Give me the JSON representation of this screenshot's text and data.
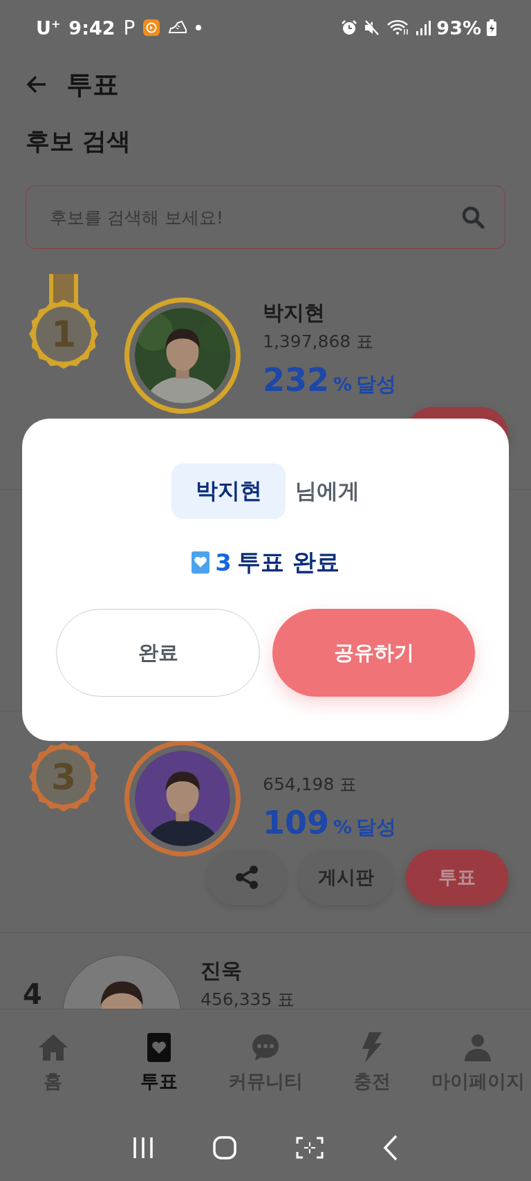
{
  "status_bar": {
    "carrier": "U$^{+}$",
    "time": "9:42",
    "app_letter": "P",
    "battery": "93%"
  },
  "header": {
    "title": "투표"
  },
  "search": {
    "heading": "후보 검색",
    "placeholder": "후보를 검색해 보세요!"
  },
  "candidates": [
    {
      "rank": "1",
      "kind": "medal",
      "color": "#d4a52a",
      "ribbon": true,
      "name": "박지현",
      "votes": "1,397,868 표",
      "percent": "232",
      "percent_unit": "%",
      "percent_label": "달성",
      "photo": {
        "kind": "picture"
      },
      "actions": [
        {
          "kind": "vote"
        }
      ]
    },
    {
      "kind": "hidden"
    },
    {
      "rank": "3",
      "kind": "medal",
      "color": "#c8703a",
      "ribbon": false,
      "votes": "654,198 표",
      "percent": "109",
      "percent_unit": "%",
      "percent_label": "달성",
      "photo": {
        "kind": "picture"
      },
      "actions": [
        {
          "kind": "share"
        },
        {
          "kind": "board",
          "label": "게시판"
        },
        {
          "kind": "vote",
          "label": "투표"
        }
      ]
    },
    {
      "rank": "4",
      "kind": "plain",
      "name": "진욱",
      "votes": "456,335 표",
      "photo": {
        "kind": "picture"
      }
    }
  ],
  "modal": {
    "recipient": "박지현",
    "recipient_suffix": "님에게",
    "count": "3",
    "result": "투표 완료",
    "buttons": [
      {
        "label": "완료",
        "kind": "secondary"
      },
      {
        "label": "공유하기",
        "kind": "primary"
      }
    ]
  },
  "bottom_nav": [
    {
      "label": "홈",
      "selected": false
    },
    {
      "label": "투표",
      "selected": true
    },
    {
      "label": "커뮤니티",
      "selected": false
    },
    {
      "label": "충전",
      "selected": false
    },
    {
      "label": "마이페이지",
      "selected": false
    }
  ]
}
